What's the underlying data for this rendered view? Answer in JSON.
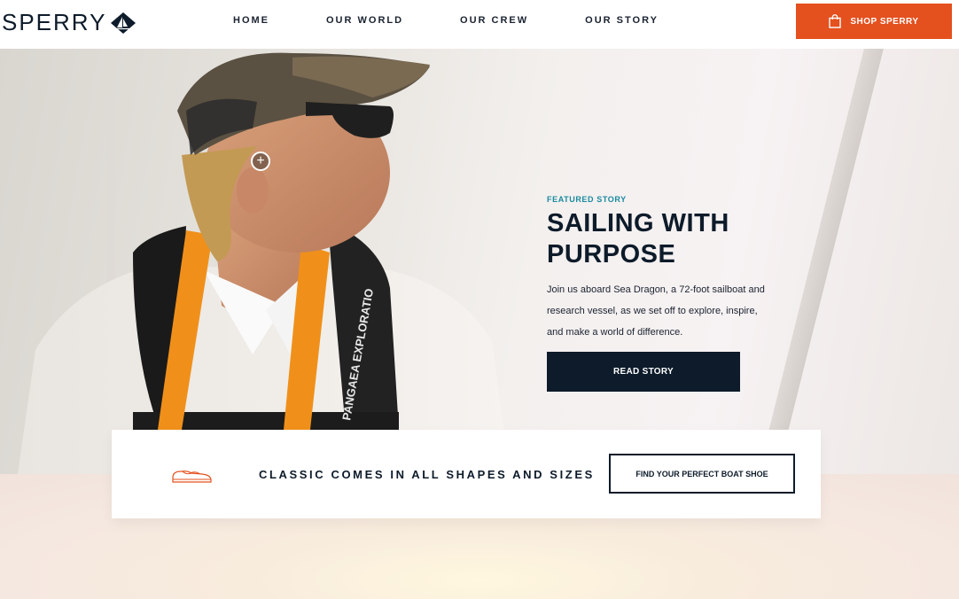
{
  "header": {
    "logo_text": "SPERRY",
    "nav": [
      "HOME",
      "OUR WORLD",
      "OUR CREW",
      "OUR STORY"
    ],
    "shop_label": "SHOP SPERRY",
    "shop_color": "#e4501e"
  },
  "hero": {
    "eyebrow": "FEATURED STORY",
    "title_line1": "SAILING WITH",
    "title_line2": "PURPOSE",
    "body": "Join us aboard Sea Dragon, a 72-foot sailboat and research vessel, as we set off to explore, inspire, and make a world of difference.",
    "cta": "READ STORY",
    "vest_text": "PANGAEA EXPLORATIO",
    "eyebrow_color": "#1a8aa0",
    "navy": "#0d1b2a"
  },
  "banner": {
    "icon": "boat-shoe-icon",
    "title": "CLASSIC COMES IN ALL SHAPES AND SIZES",
    "cta": "FIND YOUR PERFECT BOAT SHOE"
  }
}
